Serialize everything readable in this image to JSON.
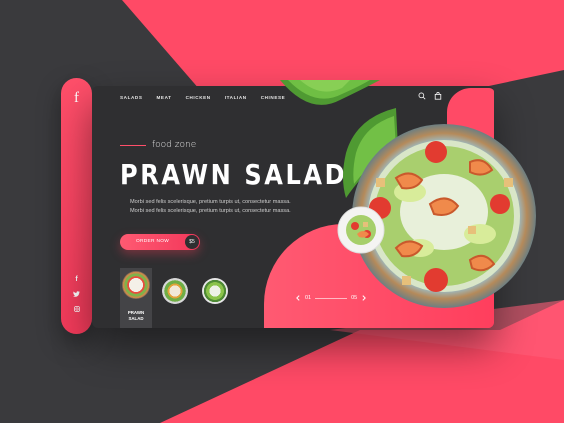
{
  "brand": {
    "logo": "f"
  },
  "nav": {
    "items": [
      "SALADS",
      "MEAT",
      "CHICKEN",
      "ITALIAN",
      "CHINESE"
    ]
  },
  "icons": {
    "search": "search-icon",
    "bag": "shopping-bag-icon",
    "prev": "chevron-left-icon",
    "next": "chevron-right-icon"
  },
  "hero": {
    "tagline": "food zone",
    "title": "PRAWN SALAD",
    "description": "Morbi sed felis scelerisque, pretium turpis ut, consectetur massa. Morbi sed felis scelerisque, pretium turpis ut, consectetur massa.",
    "order_label": "ORDER NOW",
    "price": "$5"
  },
  "thumbnails": {
    "active_label": "PRAWN SALAD"
  },
  "pager": {
    "current": "01",
    "total": "05"
  },
  "social": [
    "f",
    "t",
    "ig"
  ],
  "colors": {
    "accent": "#ff4a66",
    "card": "#2f2f31",
    "background": "#3a3a3d"
  }
}
